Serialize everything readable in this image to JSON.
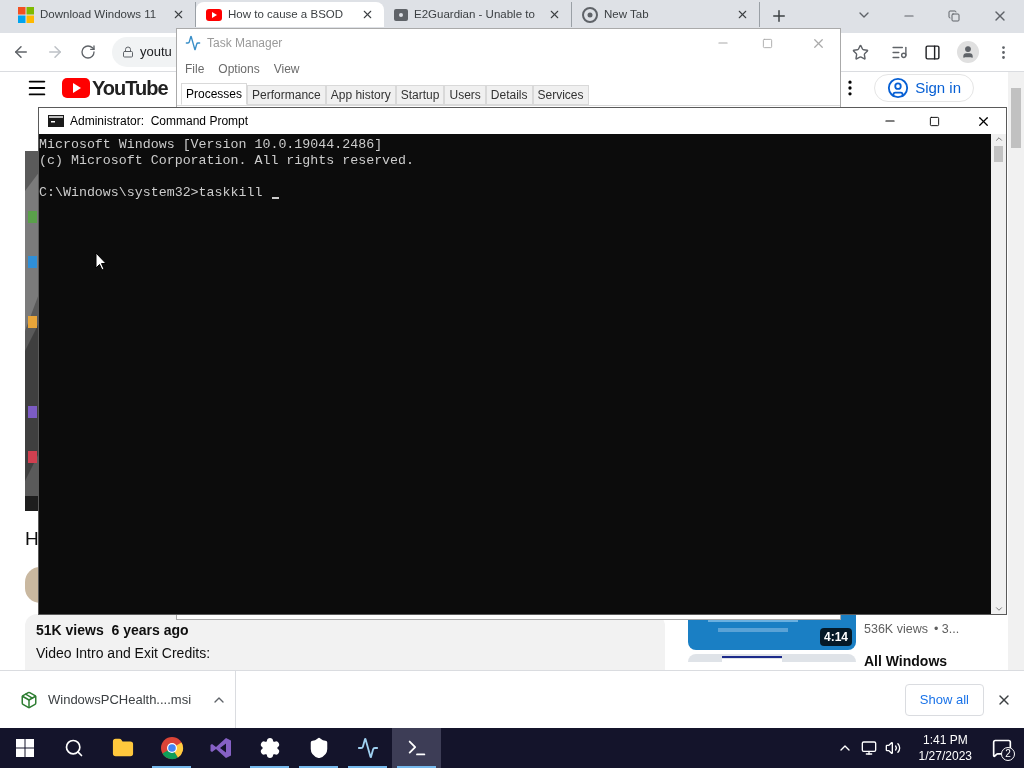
{
  "browser": {
    "tabs": [
      {
        "title": "Download Windows 11",
        "selected": false
      },
      {
        "title": "How to cause a BSOD",
        "selected": true
      },
      {
        "title": "E2Guardian - Unable to",
        "selected": false
      },
      {
        "title": "New Tab",
        "selected": false
      }
    ],
    "address": "youtu",
    "page": {
      "logo": "YouTube",
      "sign_in": "Sign in",
      "video_title": "H",
      "stats": "51K views  6 years ago",
      "description": "Video Intro and Exit Credits:",
      "related": [
        {
          "duration": "4:14",
          "views": "536K views",
          "meta": "• 3..."
        },
        {
          "title": "All Windows"
        }
      ]
    },
    "download": {
      "file": "WindowsPCHealth....msi",
      "show_all": "Show all"
    }
  },
  "task_manager": {
    "title": "Task Manager",
    "menu": [
      "File",
      "Options",
      "View"
    ],
    "tabs": [
      {
        "label": "Processes",
        "selected": true
      },
      {
        "label": "Performance",
        "selected": false
      },
      {
        "label": "App history",
        "selected": false
      },
      {
        "label": "Startup",
        "selected": false
      },
      {
        "label": "Users",
        "selected": false
      },
      {
        "label": "Details",
        "selected": false
      },
      {
        "label": "Services",
        "selected": false
      }
    ]
  },
  "command_prompt": {
    "title": "Administrator:  Command Prompt",
    "lines": [
      "Microsoft Windows [Version 10.0.19044.2486]",
      "(c) Microsoft Corporation. All rights reserved."
    ],
    "prompt": "C:\\Windows\\system32>taskkill",
    "cursor": true
  },
  "taskbar": {
    "apps": [
      {
        "kind": "start",
        "running": false,
        "active": false
      },
      {
        "kind": "search",
        "running": false,
        "active": false
      },
      {
        "kind": "explorer",
        "running": false,
        "active": false
      },
      {
        "kind": "chrome",
        "running": true,
        "active": false
      },
      {
        "kind": "studio",
        "running": false,
        "active": false
      },
      {
        "kind": "settings",
        "running": true,
        "active": false
      },
      {
        "kind": "security",
        "running": true,
        "active": false
      },
      {
        "kind": "monitor",
        "running": true,
        "active": false
      },
      {
        "kind": "terminal",
        "running": true,
        "active": true
      }
    ],
    "time": "1:41 PM",
    "date": "1/27/2023",
    "notifications": "2"
  }
}
